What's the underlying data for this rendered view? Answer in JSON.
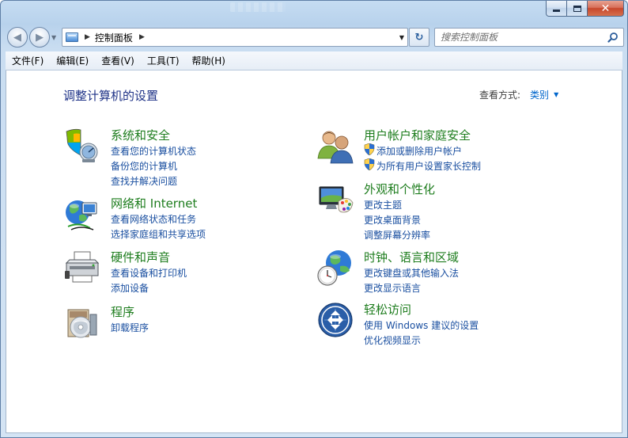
{
  "window": {
    "close_glyph": "✕"
  },
  "nav": {
    "back_glyph": "◀",
    "forward_glyph": "▶",
    "history_glyph": "▼",
    "address_separator_glyph": "▶",
    "address_location": "控制面板",
    "address_trailing_glyph": "▶",
    "address_dropdown_glyph": "▼",
    "refresh_glyph": "↻"
  },
  "search": {
    "placeholder": "搜索控制面板"
  },
  "menu": [
    "文件(F)",
    "编辑(E)",
    "查看(V)",
    "工具(T)",
    "帮助(H)"
  ],
  "page": {
    "title": "调整计算机的设置",
    "view_by_label": "查看方式:",
    "view_by_value": "类别",
    "view_by_arrow": "▼"
  },
  "categories": {
    "system_security": {
      "icon": "shield-icon",
      "title": "系统和安全",
      "links": [
        "查看您的计算机状态",
        "备份您的计算机",
        "查找并解决问题"
      ]
    },
    "network": {
      "icon": "network-globe-icon",
      "title": "网络和 Internet",
      "links": [
        "查看网络状态和任务",
        "选择家庭组和共享选项"
      ]
    },
    "hardware_sound": {
      "icon": "printer-icon",
      "title": "硬件和声音",
      "links": [
        "查看设备和打印机",
        "添加设备"
      ]
    },
    "programs": {
      "icon": "programs-disc-icon",
      "title": "程序",
      "links": [
        "卸载程序"
      ]
    },
    "user_accounts": {
      "icon": "users-icon",
      "title": "用户帐户和家庭安全",
      "links": [
        "添加或删除用户帐户",
        "为所有用户设置家长控制"
      ]
    },
    "appearance": {
      "icon": "monitor-palette-icon",
      "title": "外观和个性化",
      "links": [
        "更改主题",
        "更改桌面背景",
        "调整屏幕分辨率"
      ]
    },
    "clock_region": {
      "icon": "clock-globe-icon",
      "title": "时钟、语言和区域",
      "links": [
        "更改键盘或其他输入法",
        "更改显示语言"
      ]
    },
    "ease_of_access": {
      "icon": "ease-of-access-icon",
      "title": "轻松访问",
      "links": [
        "使用 Windows 建议的设置",
        "优化视频显示"
      ]
    }
  },
  "colors": {
    "category_title": "#1e7d1e",
    "link": "#1a4fa0",
    "page_title": "#1e3287",
    "view_by_value": "#0066cc"
  }
}
